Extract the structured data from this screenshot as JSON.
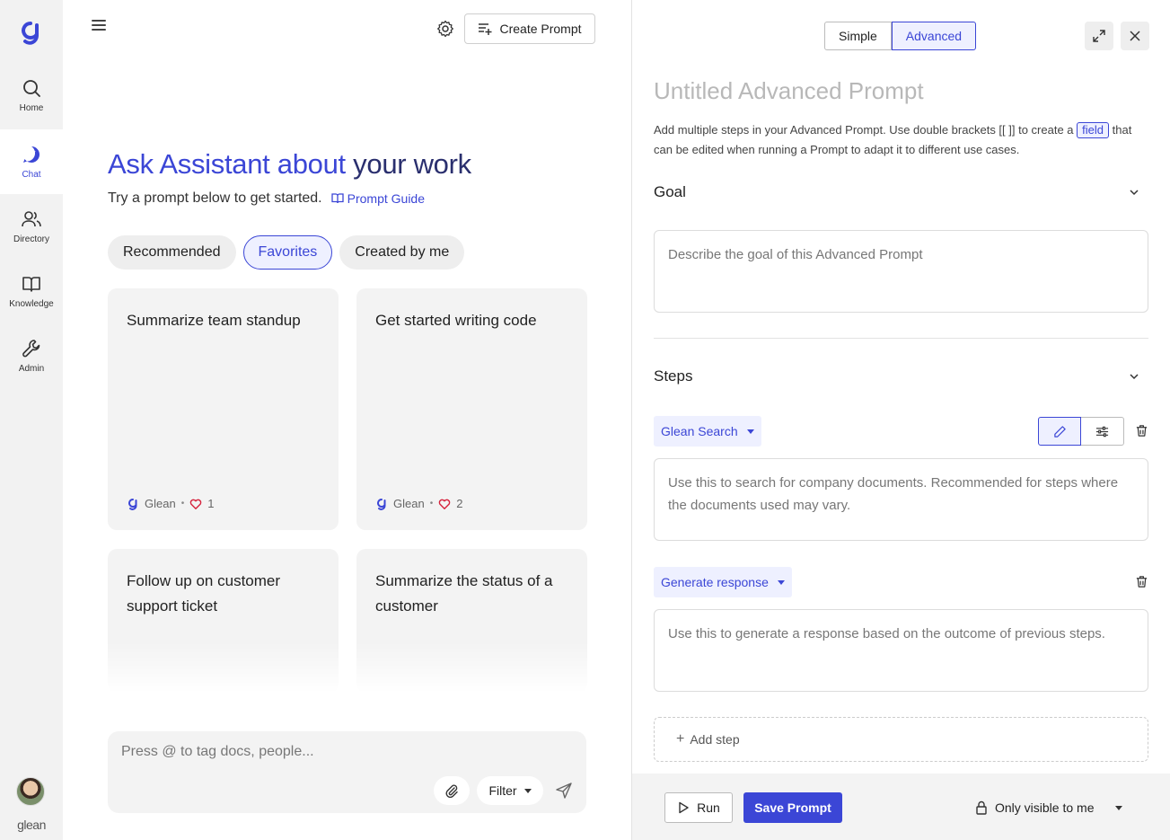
{
  "colors": {
    "accent": "#3b46d6",
    "rail_bg": "#f2f2f2",
    "card_bg": "#f3f3f3"
  },
  "rail": {
    "items": [
      {
        "label": "Home",
        "icon": "search-icon"
      },
      {
        "label": "Chat",
        "icon": "chat-icon",
        "active": true
      },
      {
        "label": "Directory",
        "icon": "people-icon"
      },
      {
        "label": "Knowledge",
        "icon": "book-icon"
      },
      {
        "label": "Admin",
        "icon": "wrench-icon"
      }
    ],
    "wordmark": "glean"
  },
  "header": {
    "create_prompt_label": "Create Prompt"
  },
  "hero": {
    "title_accent": "Ask Assistant about",
    "title_dark": "your work",
    "subtitle": "Try a prompt below to get started.",
    "guide_link": "Prompt Guide"
  },
  "filters": {
    "chips": [
      {
        "label": "Recommended"
      },
      {
        "label": "Favorites",
        "selected": true
      },
      {
        "label": "Created by me"
      }
    ]
  },
  "cards": [
    {
      "title": "Summarize team standup",
      "author": "Glean",
      "likes": "1"
    },
    {
      "title": "Get started writing code",
      "author": "Glean",
      "likes": "2"
    },
    {
      "title": "Follow up on customer support ticket"
    },
    {
      "title": "Summarize the status of a customer"
    }
  ],
  "composer": {
    "placeholder": "Press @ to tag docs, people...",
    "filter_label": "Filter"
  },
  "panel": {
    "mode_options": [
      "Simple",
      "Advanced"
    ],
    "mode_selected": "Advanced",
    "title_placeholder": "Untitled Advanced Prompt",
    "desc_before": "Add multiple steps in your Advanced Prompt. Use double brackets [[ ]] to create a",
    "desc_field_tag": "field",
    "desc_after": "that can be edited when running a Prompt to adapt it to different use cases.",
    "goal": {
      "heading": "Goal",
      "placeholder": "Describe the goal of this Advanced Prompt"
    },
    "steps": {
      "heading": "Steps",
      "items": [
        {
          "type": "Glean Search",
          "text": "Use this to search for company documents. Recommended for steps where the documents used may vary."
        },
        {
          "type": "Generate response",
          "text": "Use this to generate a response based on the outcome of previous steps."
        }
      ],
      "add_label": "Add step"
    },
    "footer": {
      "run_label": "Run",
      "save_label": "Save Prompt",
      "visibility_label": "Only visible to me"
    }
  }
}
